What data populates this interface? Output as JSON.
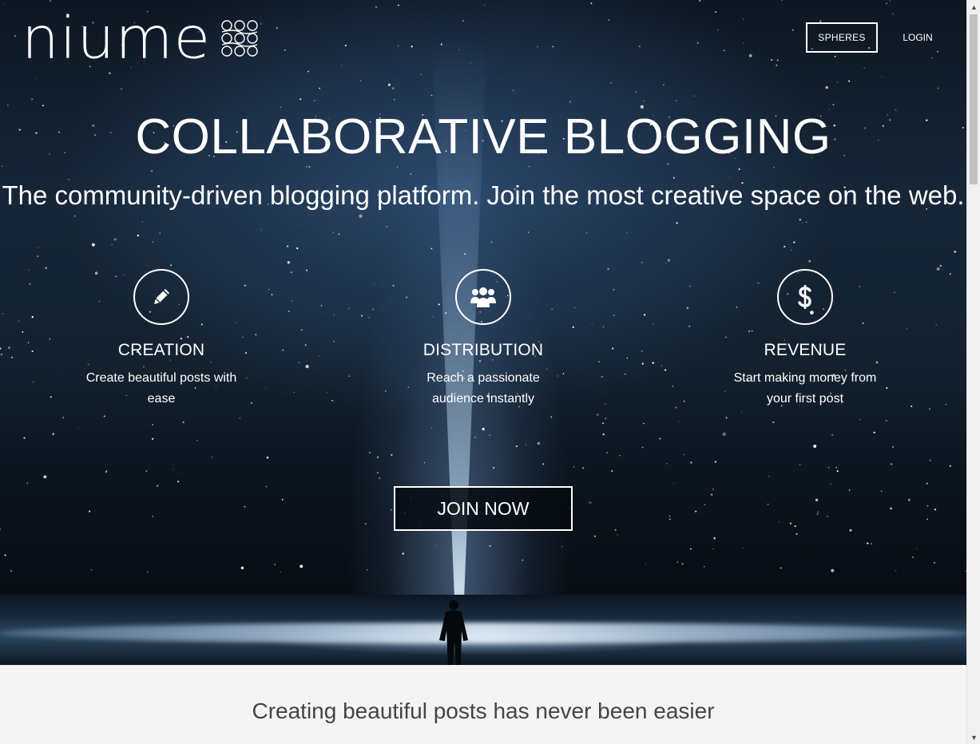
{
  "nav": {
    "logo_text": "niume",
    "spheres_label": "SPHERES",
    "login_label": "LOGIN"
  },
  "hero": {
    "headline": "COLLABORATIVE BLOGGING",
    "subline": "The community-driven blogging platform. Join the most creative space on the web.",
    "join_label": "JOIN NOW"
  },
  "features": [
    {
      "icon": "pencil-icon",
      "title": "CREATION",
      "desc": "Create beautiful posts with ease"
    },
    {
      "icon": "users-icon",
      "title": "DISTRIBUTION",
      "desc": "Reach a passionate audience instantly"
    },
    {
      "icon": "dollar-icon",
      "title": "REVENUE",
      "desc": "Start making money from your first post"
    }
  ],
  "section": {
    "title": "Creating beautiful posts has never been easier"
  },
  "colors": {
    "hero_dark": "#0e1723",
    "text_white": "#ffffff",
    "section_bg": "#f4f4f4",
    "section_text": "#444444"
  }
}
